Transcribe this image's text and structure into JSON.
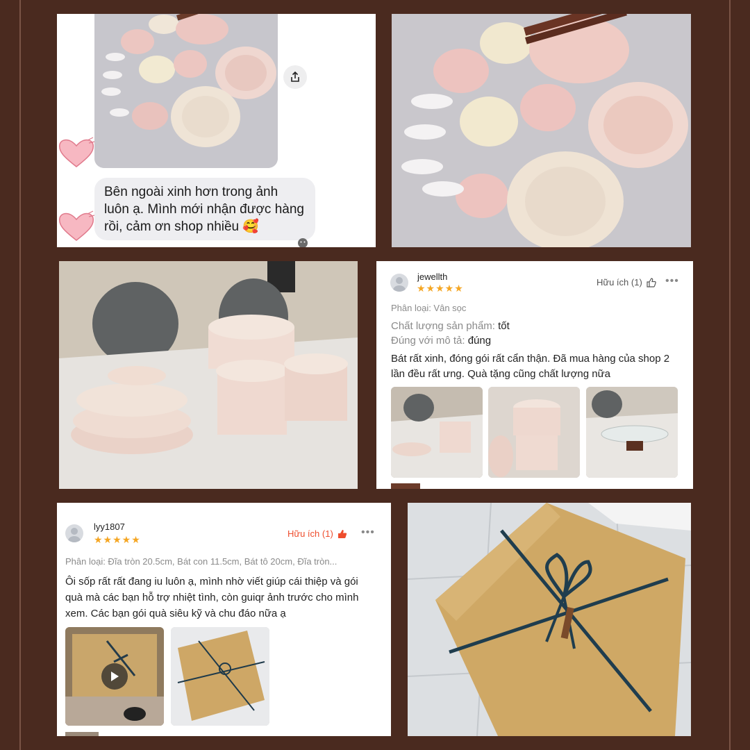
{
  "chat": {
    "message": "Bên ngoài xinh hơn trong ảnh luôn ạ. Mình mới nhận được hàng rồi, cảm ơn shop nhiều 🥰"
  },
  "review1": {
    "username": "jewellth",
    "stars": "★★★★★",
    "helpful": "Hữu ích (1)",
    "variant": "Phân loại: Vân sọc",
    "quality_label": "Chất lượng sản phẩm:",
    "quality_value": "tốt",
    "match_label": "Đúng với mô tả:",
    "match_value": "đúng",
    "text": "Bát rất xinh, đóng gói rất cẩn thận. Đã mua hàng của shop 2 lần đều rất ưng. Quà tặng cũng chất lượng nữa"
  },
  "review2": {
    "username": "lyy1807",
    "stars": "★★★★★",
    "helpful": "Hữu ích (1)",
    "variant": "Phân loại: Đĩa tròn 20.5cm, Bát con 11.5cm, Bát tô 20cm, Đĩa tròn...",
    "text": "Ôi sốp rất rất đang iu luôn ạ, mình nhờ viết giúp cái thiệp và gói quà mà các bạn hỗ trợ nhiệt tình, còn guiqr ảnh trước cho mình xem. Các bạn gói quà siêu kỹ và chu đáo nữa ạ"
  },
  "colors": {
    "background": "#4a2a1f",
    "stars": "#f5a623",
    "helpful_active": "#ee4d2d"
  },
  "icons": [
    "share-icon",
    "heart-icon",
    "thumbs-up-icon",
    "more-icon",
    "play-icon",
    "avatar-icon"
  ]
}
